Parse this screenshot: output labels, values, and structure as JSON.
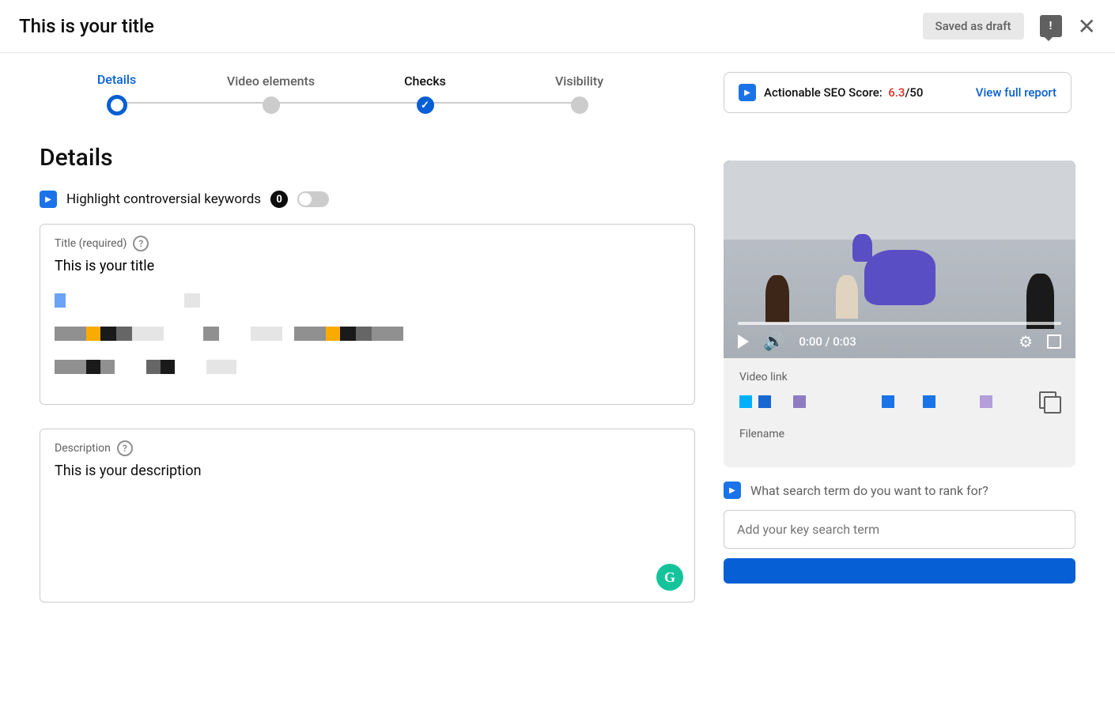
{
  "header": {
    "title": "This is your title",
    "saved_label": "Saved as draft"
  },
  "stepper": {
    "steps": [
      {
        "label": "Details"
      },
      {
        "label": "Video elements"
      },
      {
        "label": "Checks"
      },
      {
        "label": "Visibility"
      }
    ]
  },
  "seo": {
    "label": "Actionable SEO Score:",
    "score": "6.3",
    "max": "/50",
    "link": "View full report"
  },
  "details": {
    "heading": "Details",
    "highlight_label": "Highlight controversial keywords",
    "highlight_count": "0",
    "title_field": {
      "label": "Title (required)",
      "value": "This is your title"
    },
    "description_field": {
      "label": "Description",
      "value": "This is your description"
    }
  },
  "video": {
    "time": "0:00 / 0:03",
    "link_label": "Video link",
    "filename_label": "Filename"
  },
  "search": {
    "prompt": "What search term do you want to rank for?",
    "placeholder": "Add your key search term"
  }
}
